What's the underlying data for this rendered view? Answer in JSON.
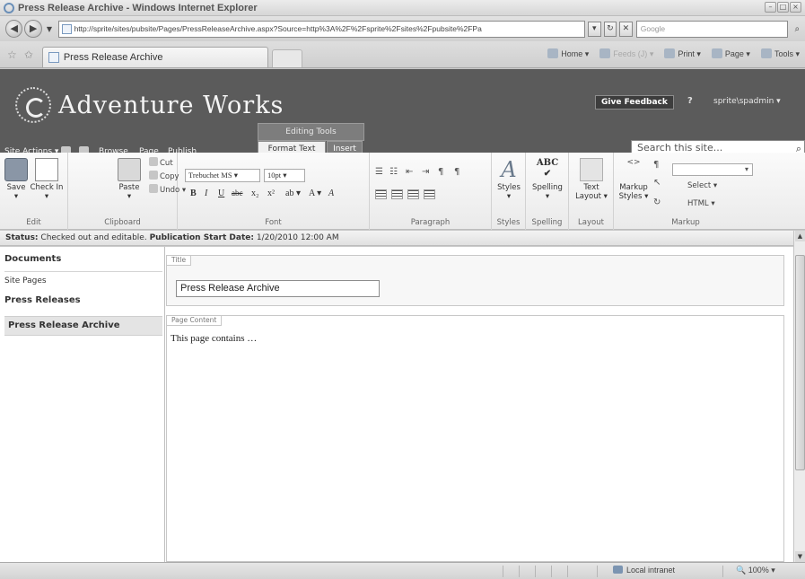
{
  "window": {
    "title": "Press Release Archive - Windows Internet Explorer"
  },
  "browser": {
    "url": "http://sprite/sites/pubsite/Pages/PressReleaseArchive.aspx?Source=http%3A%2F%2Fsprite%2Fsites%2Fpubsite%2FPa",
    "search_placeholder": "Google",
    "tab_title": "Press Release Archive",
    "commands": [
      "Home",
      "Feeds (J)",
      "Print",
      "Page",
      "Tools"
    ]
  },
  "site": {
    "logo_text": "Adventure Works",
    "feedback_label": "Give Feedback",
    "help_label": "?",
    "user": "sprite\\spadmin",
    "search_placeholder": "Search this site..."
  },
  "ribbon": {
    "site_actions": "Site Actions",
    "tabs": [
      "Browse",
      "Page",
      "Publish",
      "Format Text",
      "Insert"
    ],
    "editing_tools_label": "Editing Tools",
    "edit_group": {
      "label": "Edit",
      "save": "Save",
      "check_in": "Check In"
    },
    "clipboard_group": {
      "label": "Clipboard",
      "paste": "Paste",
      "cut": "Cut",
      "copy": "Copy",
      "undo": "Undo"
    },
    "font_group": {
      "label": "Font",
      "font_name": "Trebuchet MS",
      "font_size": "10pt"
    },
    "paragraph_group": {
      "label": "Paragraph"
    },
    "styles_group": {
      "label": "Styles",
      "button": "Styles"
    },
    "spelling_group": {
      "label": "Spelling",
      "button": "Spelling"
    },
    "layout_group": {
      "label": "Layout",
      "button_line1": "Text",
      "button_line2": "Layout"
    },
    "markup_group": {
      "label": "Markup",
      "markup_styles_line1": "Markup",
      "markup_styles_line2": "Styles",
      "select": "Select",
      "html": "HTML"
    }
  },
  "status_bar": {
    "status_label": "Status:",
    "status_text": "Checked out and editable.",
    "pub_label": "Publication Start Date:",
    "pub_value": "1/20/2010 12:00 AM"
  },
  "quick_launch": {
    "documents": "Documents",
    "site_pages": "Site Pages",
    "press_releases": "Press Releases",
    "press_release_archive": "Press Release Archive"
  },
  "page": {
    "title_zone_label": "Title",
    "title_value": "Press Release Archive",
    "content_zone_label": "Page Content",
    "content_text": "This page contains …"
  },
  "ie_status": {
    "zone": "Local intranet",
    "zoom": "100%"
  }
}
